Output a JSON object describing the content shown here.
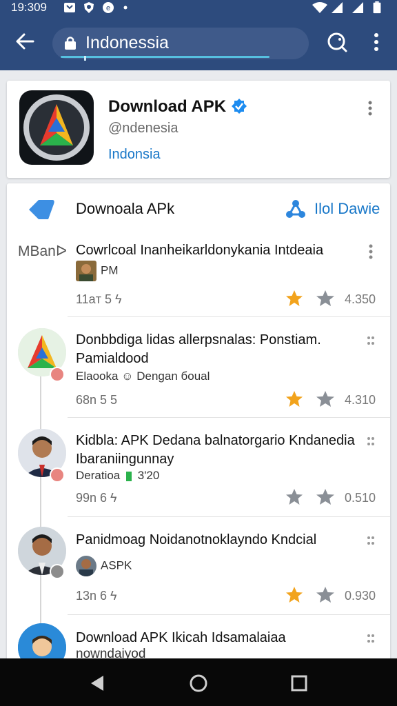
{
  "status": {
    "time": "19:309"
  },
  "urlbar": {
    "url": "Indonessia",
    "progress": 0.78
  },
  "profile": {
    "name": "Download APK",
    "handle": "@ndenesia",
    "link": "Indonsia",
    "verified": true
  },
  "feed": {
    "header_title": "Downoala APk",
    "header_action": "Ilol Dawie",
    "posts": [
      {
        "source": "MBanᐅ",
        "title": "Cowrlcoal Inanheikarldonykania Intdeaia",
        "meta": "PM",
        "time": "11aт 5 ϟ",
        "count": "4.350",
        "starred": true
      },
      {
        "title": "Donbbdiga lidas allerpsnalas: Ponstiam. Pamialdood",
        "meta": "Elaooka ☺ Dengan бoual",
        "time": "68n 5 5",
        "count": "4.310",
        "starred": true
      },
      {
        "title": "Kidbla: APK Dedana balnatorgario Kndanedia Ibaraniingunnay",
        "meta": "Deratioa",
        "meta_tag": "3'20",
        "time": "99n 6 ϟ",
        "count": "0.510",
        "starred": false
      },
      {
        "title": "Panidmoag Noidanotnoklayndo Kndcial",
        "meta": "ASPK",
        "time": "13n 6 ϟ",
        "count": "0.930",
        "starred": true
      },
      {
        "title": "Download APK Ikicah Idsamalaiaa",
        "meta": "nowndaiyod"
      }
    ]
  },
  "colors": {
    "appbar": "#2d4b7d",
    "link": "#1877c8",
    "star_active": "#f2a31c",
    "star_inactive": "#8a8f96"
  }
}
